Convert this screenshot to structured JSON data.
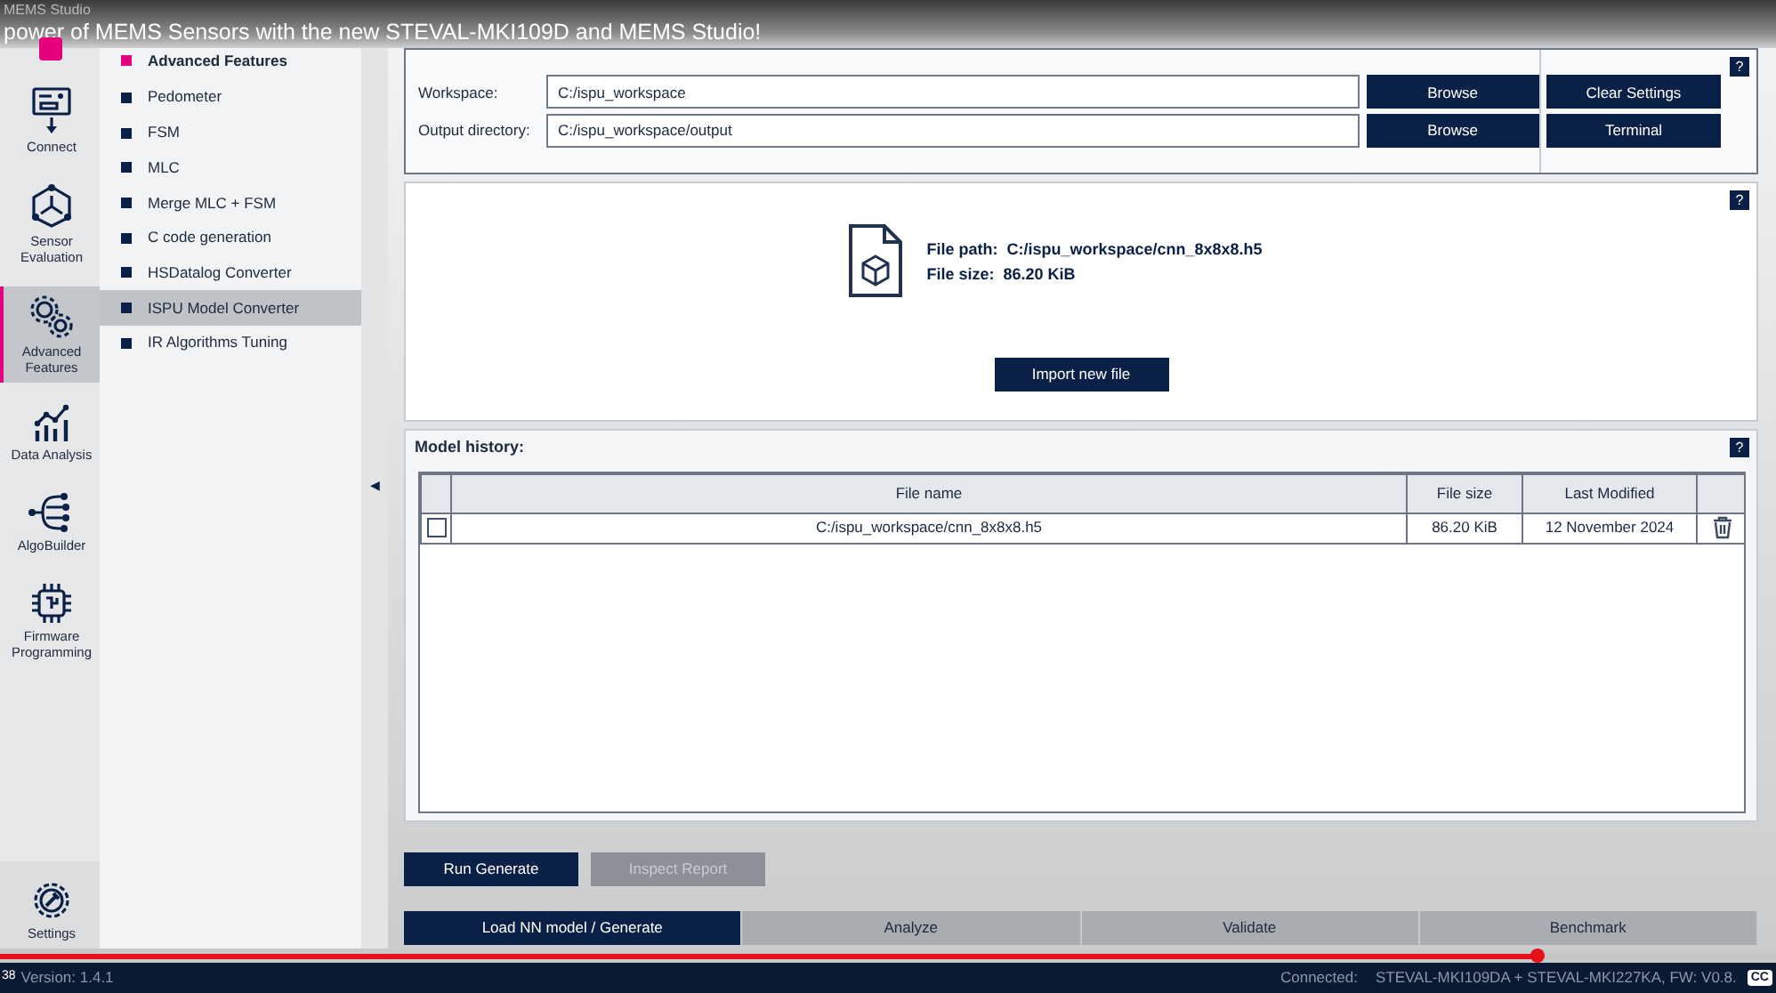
{
  "window": {
    "title": "MEMS Studio"
  },
  "video_overlay": {
    "title": "power of MEMS Sensors with the new STEVAL-MKI109D and MEMS Studio!",
    "time": "38",
    "cc": "CC",
    "progress": {
      "level": 0.866
    }
  },
  "rail": {
    "items": [
      {
        "label": "Connect",
        "kind": "connect",
        "selected": false
      },
      {
        "label": "Sensor Evaluation",
        "kind": "sensor",
        "selected": false
      },
      {
        "label": "Advanced Features",
        "kind": "gears",
        "selected": true
      },
      {
        "label": "Data Analysis",
        "kind": "chart",
        "selected": false
      },
      {
        "label": "AlgoBuilder",
        "kind": "tree",
        "selected": false
      },
      {
        "label": "Firmware Programming",
        "kind": "chip",
        "selected": false
      }
    ],
    "settings": {
      "label": "Settings",
      "selected": false
    }
  },
  "submenu": {
    "title": "Advanced Features",
    "items": [
      {
        "label": "Pedometer",
        "selected": false
      },
      {
        "label": "FSM",
        "selected": false
      },
      {
        "label": "MLC",
        "selected": false
      },
      {
        "label": "Merge MLC + FSM",
        "selected": false
      },
      {
        "label": "C code generation",
        "selected": false
      },
      {
        "label": "HSDatalog Converter",
        "selected": false
      },
      {
        "label": "ISPU Model Converter",
        "selected": true
      },
      {
        "label": "IR Algorithms Tuning",
        "selected": false
      }
    ],
    "collapse_toggle": "◀"
  },
  "workspace": {
    "help": "?",
    "fields": [
      {
        "label": "Workspace:",
        "value": "C:/ispu_workspace",
        "button": "Browse",
        "action": "Clear Settings"
      },
      {
        "label": "Output directory:",
        "value": "C:/ispu_workspace/output",
        "button": "Browse",
        "action": "Terminal"
      }
    ]
  },
  "file": {
    "help": "?",
    "path_label": "File path:",
    "path": "C:/ispu_workspace/cnn_8x8x8.h5",
    "size_label": "File size:",
    "size": "86.20 KiB",
    "button": "Import new file"
  },
  "history": {
    "title": "Model history:",
    "help": "?",
    "columns": [
      "File name",
      "File size",
      "Last Modified"
    ],
    "rows": [
      {
        "checked": false,
        "file_name": "C:/ispu_workspace/cnn_8x8x8.h5",
        "file_size": "86.20 KiB",
        "last_modified": "12 November 2024"
      }
    ]
  },
  "actions": [
    {
      "label": "Run Generate",
      "disabled": false
    },
    {
      "label": "Inspect Report",
      "disabled": true
    }
  ],
  "tabs": [
    {
      "label": "Load NN model / Generate",
      "selected": true
    },
    {
      "label": "Analyze",
      "selected": false
    },
    {
      "label": "Validate",
      "selected": false
    },
    {
      "label": "Benchmark",
      "selected": false
    }
  ],
  "status_bar": {
    "version": "Version: 1.4.1",
    "connected_label": "Connected:",
    "connected": "STEVAL-MKI109DA + STEVAL-MKI227KA, FW: V0.8."
  }
}
